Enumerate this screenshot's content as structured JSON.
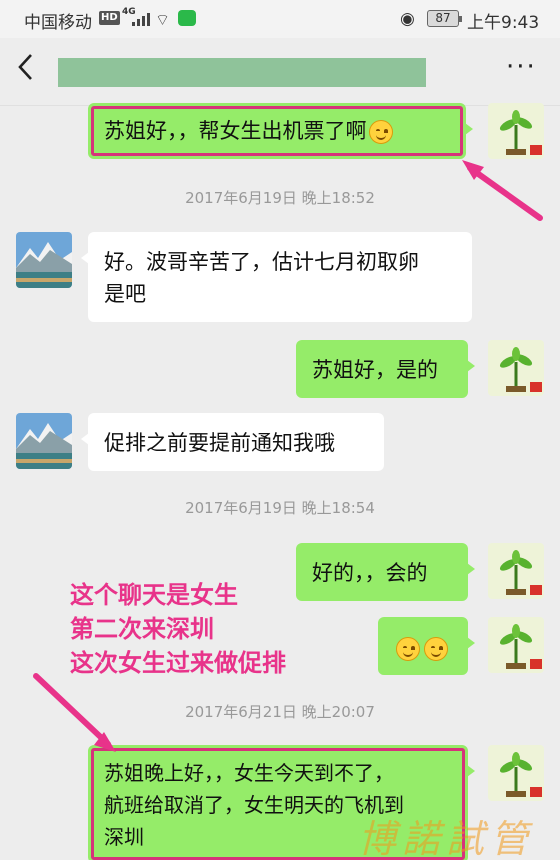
{
  "status_bar": {
    "carrier": "中国移动",
    "hd": "HD",
    "network": "4G",
    "battery": "87",
    "time": "上午9:43"
  },
  "nav": {
    "back_icon": "chevron-left-icon",
    "more_label": "···"
  },
  "messages": [
    {
      "side": "out",
      "text_before_emoji": "苏姐好，，帮女生出机票了啊",
      "emoji_count": 1,
      "highlighted": true
    },
    {
      "timestamp": "2017年6月19日 晚上18:52"
    },
    {
      "side": "in",
      "lines": [
        "好。波哥辛苦了，估计七月初取卵",
        "是吧"
      ]
    },
    {
      "side": "out",
      "text": "苏姐好，是的"
    },
    {
      "side": "in",
      "text": "促排之前要提前通知我哦"
    },
    {
      "timestamp": "2017年6月19日 晚上18:54"
    },
    {
      "side": "out",
      "text": "好的，，会的"
    },
    {
      "side": "out",
      "emoji_count": 2
    },
    {
      "timestamp": "2017年6月21日 晚上20:07"
    },
    {
      "side": "out",
      "lines": [
        "苏姐晚上好，，女生今天到不了，",
        "航班给取消了，女生明天的飞机到",
        "深圳"
      ],
      "highlighted": true
    }
  ],
  "annotation": {
    "lines": [
      "这个聊天是女生",
      "第二次来深圳",
      "这次女生过来做促排"
    ],
    "color": "#e8338a"
  },
  "watermark": "博諾試管",
  "colors": {
    "outgoing_bubble": "#95ec69",
    "incoming_bubble": "#ffffff",
    "highlight": "#d6337a",
    "background": "#ededed"
  }
}
